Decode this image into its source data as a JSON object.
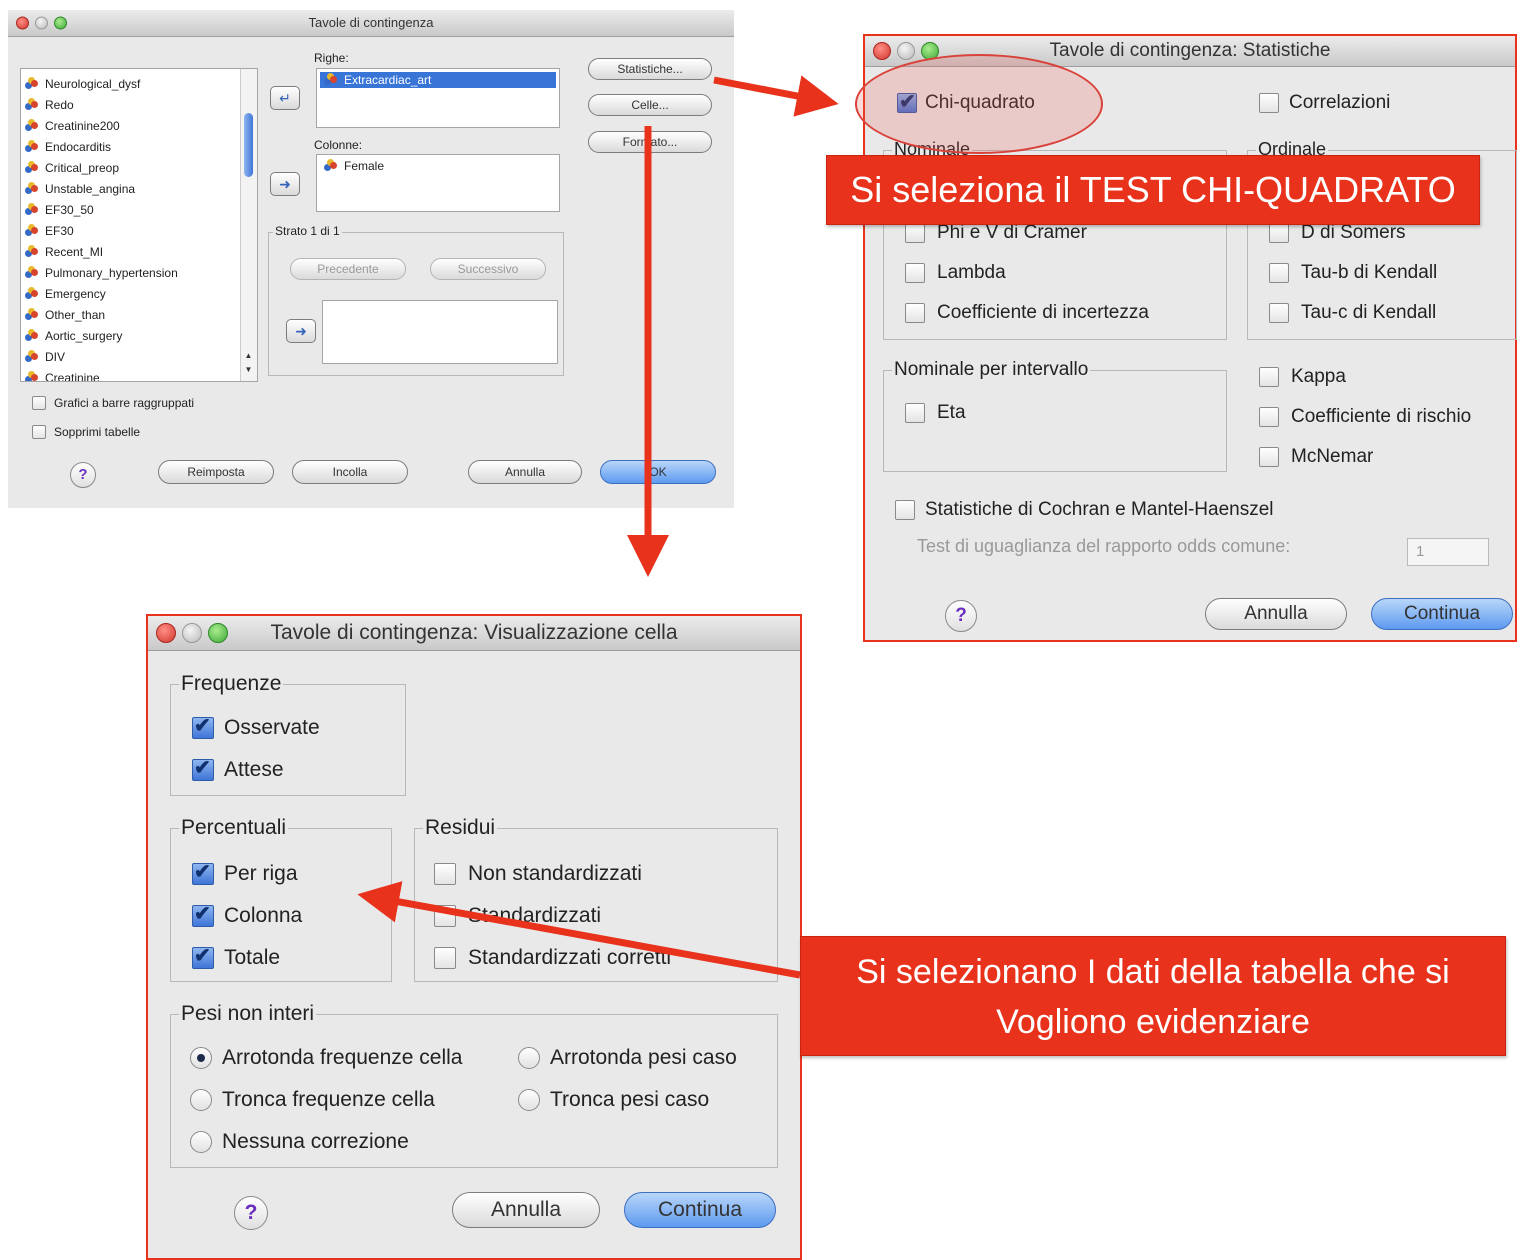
{
  "crosstabs_dialog": {
    "title": "Tavole di contingenza",
    "variables": [
      "Neurological_dysf",
      "Redo",
      "Creatinine200",
      "Endocarditis",
      "Critical_preop",
      "Unstable_angina",
      "EF30_50",
      "EF30",
      "Recent_MI",
      "Pulmonary_hypertension",
      "Emergency",
      "Other_than",
      "Aortic_surgery",
      "DIV",
      "Creatinine"
    ],
    "rows_label": "Righe:",
    "rows_value": "Extracardiac_art",
    "columns_label": "Colonne:",
    "columns_value": "Female",
    "layer_label": "Strato 1 di 1",
    "previous_button": "Precedente",
    "next_button": "Successivo",
    "statistics_button": "Statistiche...",
    "cells_button": "Celle...",
    "format_button": "Formato...",
    "clustered_bars_label": "Grafici a barre raggruppati",
    "suppress_tables_label": "Sopprimi tabelle",
    "reset_button": "Reimposta",
    "paste_button": "Incolla",
    "cancel_button": "Annulla",
    "ok_button": "OK",
    "help_glyph": "?",
    "arrow_glyph": "➜"
  },
  "statistics_dialog": {
    "title": "Tavole di contingenza: Statistiche",
    "chi_square_label": "Chi-quadrato",
    "chi_square_checked": true,
    "correlations_label": "Correlazioni",
    "nominal_title": "Nominale",
    "ordinal_title": "Ordinale",
    "phi_cramer_label": "Phi e V di Cramer",
    "lambda_label": "Lambda",
    "uncertainty_label": "Coefficiente di incertezza",
    "somers_label": "D di Somers",
    "kendall_b_label": "Tau-b di Kendall",
    "kendall_c_label": "Tau-c di Kendall",
    "nominal_interval_title": "Nominale per intervallo",
    "eta_label": "Eta",
    "kappa_label": "Kappa",
    "risk_label": "Coefficiente di rischio",
    "mcnemar_label": "McNemar",
    "cochran_label": "Statistiche di Cochran e Mantel-Haenszel",
    "odds_test_label": "Test di uguaglianza del rapporto odds comune:",
    "odds_value": "1",
    "cancel_button": "Annulla",
    "continue_button": "Continua",
    "help_glyph": "?"
  },
  "cells_dialog": {
    "title": "Tavole di contingenza: Visualizzazione cella",
    "counts_title": "Frequenze",
    "observed_label": "Osservate",
    "expected_label": "Attese",
    "percentages_title": "Percentuali",
    "row_label": "Per riga",
    "column_label": "Colonna",
    "total_label": "Totale",
    "residuals_title": "Residui",
    "unstandardized_label": "Non standardizzati",
    "standardized_label": "Standardizzati",
    "adj_standardized_label": "Standardizzati corretti",
    "noninteger_title": "Pesi non interi",
    "round_cell_label": "Arrotonda frequenze cella",
    "round_case_label": "Arrotonda pesi caso",
    "truncate_cell_label": "Tronca frequenze cella",
    "truncate_case_label": "Tronca pesi caso",
    "no_adjust_label": "Nessuna correzione",
    "cancel_button": "Annulla",
    "continue_button": "Continua",
    "help_glyph": "?"
  },
  "annotations": {
    "chi_square_banner": "Si seleziona il TEST CHI-QUADRATO",
    "cells_banner_line1": "Si selezionano I dati della tabella che si",
    "cells_banner_line2": "Vogliono evidenziare",
    "arrow_color": "#e8321c"
  }
}
